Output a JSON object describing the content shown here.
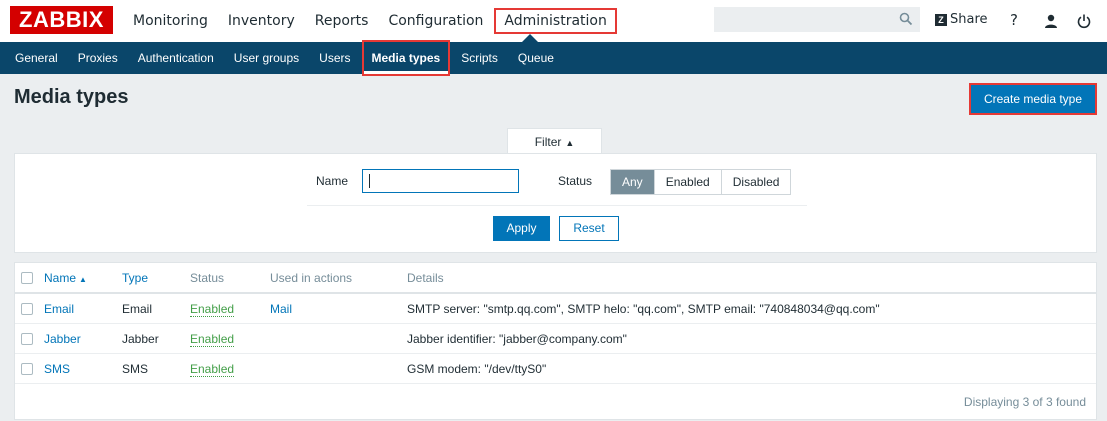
{
  "brand": {
    "logo_text": "ZABBIX"
  },
  "main_menu": {
    "items": [
      {
        "label": "Monitoring"
      },
      {
        "label": "Inventory"
      },
      {
        "label": "Reports"
      },
      {
        "label": "Configuration"
      },
      {
        "label": "Administration",
        "active": true
      }
    ]
  },
  "topbar": {
    "search_value": "",
    "search_icon": "search-icon",
    "share_logo": "Z",
    "share_label": "Share",
    "help_icon": "?",
    "user_icon": "user-icon",
    "logout_icon": "power-icon"
  },
  "sub_menu": {
    "items": [
      {
        "label": "General"
      },
      {
        "label": "Proxies"
      },
      {
        "label": "Authentication"
      },
      {
        "label": "User groups"
      },
      {
        "label": "Users"
      },
      {
        "label": "Media types",
        "active": true
      },
      {
        "label": "Scripts"
      },
      {
        "label": "Queue"
      }
    ]
  },
  "page": {
    "title": "Media types",
    "create_button": "Create media type"
  },
  "filter": {
    "tab_label": "Filter",
    "name_label": "Name",
    "name_value": "",
    "status_label": "Status",
    "status_options": [
      "Any",
      "Enabled",
      "Disabled"
    ],
    "status_selected": "Any",
    "apply_label": "Apply",
    "reset_label": "Reset"
  },
  "table": {
    "columns": [
      "Name",
      "Type",
      "Status",
      "Used in actions",
      "Details"
    ],
    "rows": [
      {
        "name": "Email",
        "type": "Email",
        "status": "Enabled",
        "used_in_actions": "Mail",
        "details": "SMTP server: \"smtp.qq.com\", SMTP helo: \"qq.com\", SMTP email: \"740848034@qq.com\""
      },
      {
        "name": "Jabber",
        "type": "Jabber",
        "status": "Enabled",
        "used_in_actions": "",
        "details": "Jabber identifier: \"jabber@company.com\""
      },
      {
        "name": "SMS",
        "type": "SMS",
        "status": "Enabled",
        "used_in_actions": "",
        "details": "GSM modem: \"/dev/ttyS0\""
      }
    ],
    "footer": "Displaying 3 of 3 found"
  },
  "colors": {
    "brand_red": "#d40000",
    "nav_blue": "#0a466a",
    "primary_blue": "#0275b8",
    "enabled_green": "#429e47",
    "highlight_red": "#e53935"
  }
}
